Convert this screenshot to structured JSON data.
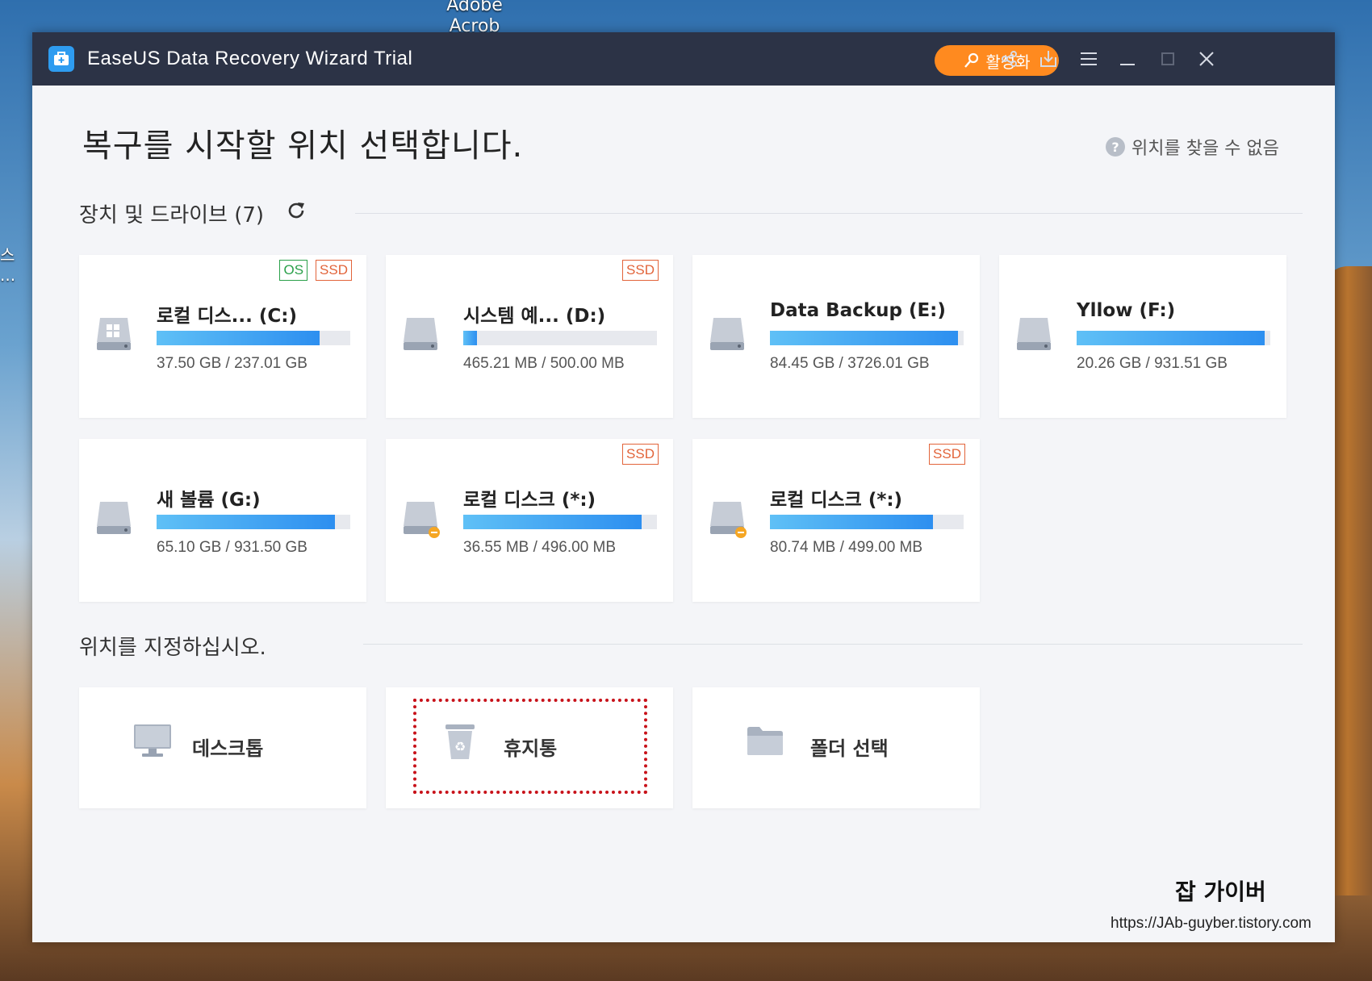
{
  "desktop": {
    "icon_label": "Adobe Acrob",
    "left_label": "스\n..."
  },
  "window": {
    "title": "EaseUS Data Recovery Wizard  Trial",
    "activate_label": "활성화",
    "icons": [
      "share-icon",
      "download-icon",
      "menu-icon",
      "minimize-icon",
      "maximize-icon",
      "close-icon"
    ]
  },
  "main": {
    "heading": "복구를 시작할 위치 선택합니다.",
    "help_link": "위치를 찾을 수 없음",
    "devices_section": "장치 및 드라이브 (7)",
    "location_section": "위치를 지정하십시오."
  },
  "drives": [
    {
      "name": "로컬 디스...  (C:)",
      "size": "37.50 GB / 237.01 GB",
      "badges": [
        "OS",
        "SSD"
      ],
      "used": 0.84,
      "icon": "windows-drive-icon"
    },
    {
      "name": "시스템 예...  (D:)",
      "size": "465.21 MB / 500.00 MB",
      "badges": [
        "SSD"
      ],
      "used": 0.07,
      "icon": "drive-icon"
    },
    {
      "name": "Data Backup (E:)",
      "size": "84.45 GB / 3726.01 GB",
      "badges": [],
      "used": 0.97,
      "icon": "drive-icon"
    },
    {
      "name": "Yllow (F:)",
      "size": "20.26 GB / 931.51 GB",
      "badges": [],
      "used": 0.97,
      "icon": "drive-icon"
    },
    {
      "name": "새 볼륨 (G:)",
      "size": "65.10 GB / 931.50 GB",
      "badges": [],
      "used": 0.92,
      "icon": "drive-icon"
    },
    {
      "name": "로컬 디스크 (*:)",
      "size": "36.55 MB / 496.00 MB",
      "badges": [
        "SSD"
      ],
      "used": 0.92,
      "icon": "drive-warning-icon"
    },
    {
      "name": "로컬 디스크 (*:)",
      "size": "80.74 MB / 499.00 MB",
      "badges": [
        "SSD"
      ],
      "used": 0.84,
      "icon": "drive-warning-icon"
    }
  ],
  "locations": [
    {
      "label": "데스크톱",
      "icon": "desktop-icon"
    },
    {
      "label": "휴지통",
      "icon": "recycle-bin-icon"
    },
    {
      "label": "폴더 선택",
      "icon": "folder-icon"
    }
  ],
  "watermark": {
    "title": "잡 가이버",
    "url": "https://JAb-guyber.tistory.com"
  },
  "colors": {
    "titlebar": "#2c3346",
    "accent": "#ff8a1f",
    "bar": "#2d8ff0",
    "highlight": "#c8121a"
  }
}
